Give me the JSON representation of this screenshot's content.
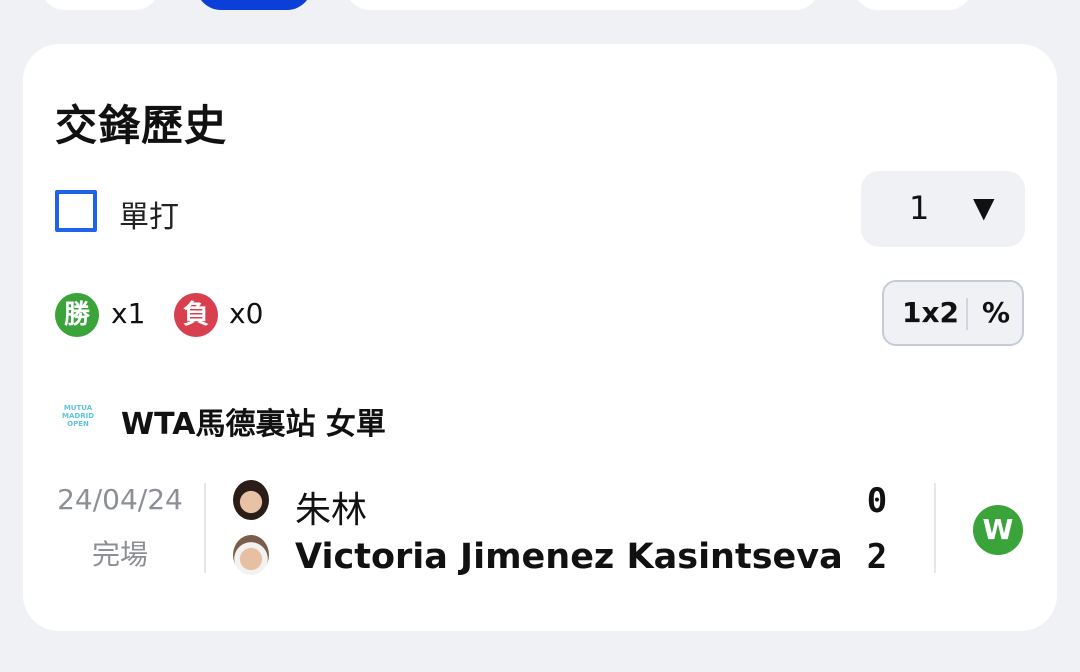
{
  "section": {
    "title": "交鋒歷史"
  },
  "filter": {
    "checkbox_label": "單打",
    "count_value": "1",
    "count_caret": "▼"
  },
  "summary": {
    "win_badge": "勝",
    "win_count": "x1",
    "loss_badge": "負",
    "loss_count": "x0"
  },
  "odds_toggle": {
    "option1": "1x2",
    "option2": "%"
  },
  "tournament": {
    "logo_text": "MUTUA MADRID OPEN",
    "name": "WTA馬德裏站 女單"
  },
  "match": {
    "date": "24/04/24",
    "status": "完場",
    "player1": {
      "name": "朱林",
      "score": "0"
    },
    "player2": {
      "name": "Victoria Jimenez Kasintseva",
      "score": "2"
    },
    "result": "W"
  },
  "colors": {
    "accent": "#1e63e9",
    "win": "#3aa339",
    "loss": "#d9404f",
    "active_pill": "#0a3fd8"
  }
}
